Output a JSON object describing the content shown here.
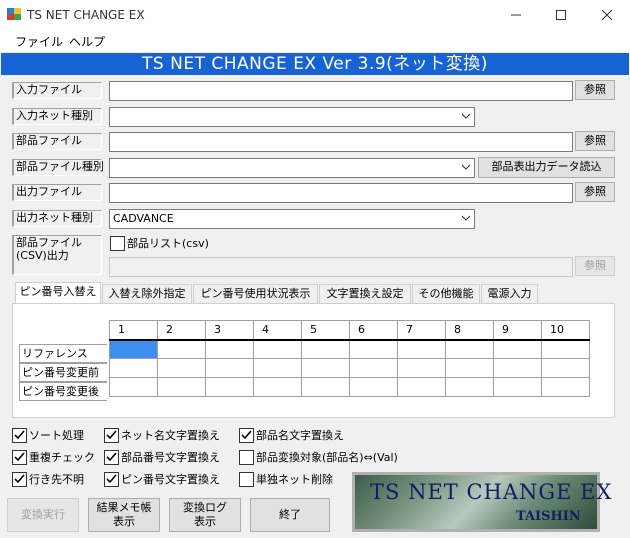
{
  "window": {
    "title": "TS NET CHANGE EX"
  },
  "menu": {
    "file": "ファイル",
    "help": "ヘルプ"
  },
  "banner": "TS NET CHANGE EX Ver 3.9(ネット変換)",
  "form": {
    "input_file_label": "入力ファイル",
    "input_net_type_label": "入力ネット種別",
    "parts_file_label": "部品ファイル",
    "parts_file_type_label": "部品ファイル種別",
    "output_file_label": "出力ファイル",
    "output_net_type_label": "出力ネット種別",
    "output_net_type_value": "CADVANCE",
    "parts_csv_label_1": "部品ファイル",
    "parts_csv_label_2": "(CSV)出力",
    "parts_list_csv_label": "部品リスト(csv)",
    "browse_label": "参照",
    "parts_output_read_label": "部品表出力データ読込"
  },
  "tabs": [
    "ピン番号入替え",
    "入替え除外指定",
    "ピン番号使用状況表示",
    "文字置換え設定",
    "その他機能",
    "電源入力"
  ],
  "grid": {
    "columns": [
      "1",
      "2",
      "3",
      "4",
      "5",
      "6",
      "7",
      "8",
      "9",
      "10"
    ],
    "rows": [
      "リファレンス",
      "ピン番号変更前",
      "ピン番号変更後"
    ]
  },
  "options": [
    {
      "label": "ソート処理",
      "checked": true
    },
    {
      "label": "重複チェック",
      "checked": true
    },
    {
      "label": "行き先不明",
      "checked": true
    },
    {
      "label": "ネット名文字置換え",
      "checked": true
    },
    {
      "label": "部品番号文字置換え",
      "checked": true
    },
    {
      "label": "ピン番号文字置換え",
      "checked": true
    },
    {
      "label": "部品名文字置換え",
      "checked": true
    },
    {
      "label": "部品変換対象(部品名)⇔(Val)",
      "checked": false
    },
    {
      "label": "単独ネット削除",
      "checked": false
    }
  ],
  "buttons": {
    "convert": "変換実行",
    "result_memo_1": "結果メモ帳",
    "result_memo_2": "表示",
    "log_1": "変換ログ",
    "log_2": "表示",
    "exit": "終了"
  },
  "logo": {
    "main": "TS NET CHANGE EX",
    "sub": "TAISHIN"
  },
  "colors": {
    "banner": "#1763d6",
    "selected_cell": "#3c8ef0"
  }
}
